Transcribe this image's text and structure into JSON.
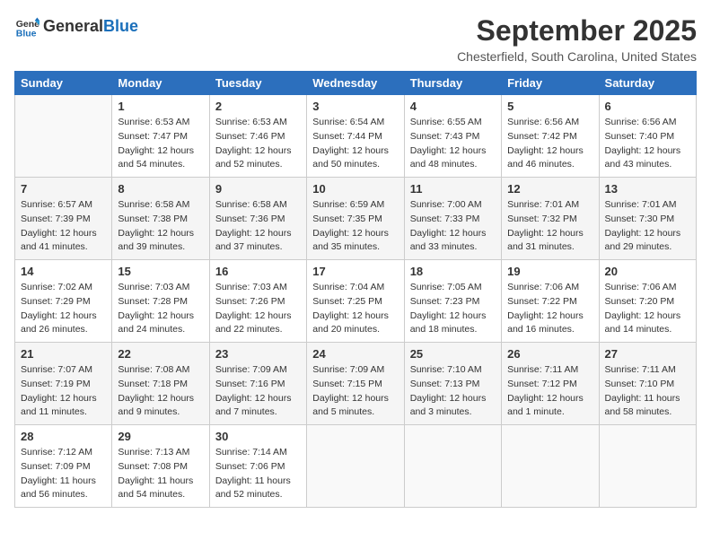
{
  "header": {
    "logo_general": "General",
    "logo_blue": "Blue",
    "month_title": "September 2025",
    "location": "Chesterfield, South Carolina, United States"
  },
  "days_of_week": [
    "Sunday",
    "Monday",
    "Tuesday",
    "Wednesday",
    "Thursday",
    "Friday",
    "Saturday"
  ],
  "weeks": [
    [
      {
        "day": "",
        "info": ""
      },
      {
        "day": "1",
        "info": "Sunrise: 6:53 AM\nSunset: 7:47 PM\nDaylight: 12 hours\nand 54 minutes."
      },
      {
        "day": "2",
        "info": "Sunrise: 6:53 AM\nSunset: 7:46 PM\nDaylight: 12 hours\nand 52 minutes."
      },
      {
        "day": "3",
        "info": "Sunrise: 6:54 AM\nSunset: 7:44 PM\nDaylight: 12 hours\nand 50 minutes."
      },
      {
        "day": "4",
        "info": "Sunrise: 6:55 AM\nSunset: 7:43 PM\nDaylight: 12 hours\nand 48 minutes."
      },
      {
        "day": "5",
        "info": "Sunrise: 6:56 AM\nSunset: 7:42 PM\nDaylight: 12 hours\nand 46 minutes."
      },
      {
        "day": "6",
        "info": "Sunrise: 6:56 AM\nSunset: 7:40 PM\nDaylight: 12 hours\nand 43 minutes."
      }
    ],
    [
      {
        "day": "7",
        "info": "Sunrise: 6:57 AM\nSunset: 7:39 PM\nDaylight: 12 hours\nand 41 minutes."
      },
      {
        "day": "8",
        "info": "Sunrise: 6:58 AM\nSunset: 7:38 PM\nDaylight: 12 hours\nand 39 minutes."
      },
      {
        "day": "9",
        "info": "Sunrise: 6:58 AM\nSunset: 7:36 PM\nDaylight: 12 hours\nand 37 minutes."
      },
      {
        "day": "10",
        "info": "Sunrise: 6:59 AM\nSunset: 7:35 PM\nDaylight: 12 hours\nand 35 minutes."
      },
      {
        "day": "11",
        "info": "Sunrise: 7:00 AM\nSunset: 7:33 PM\nDaylight: 12 hours\nand 33 minutes."
      },
      {
        "day": "12",
        "info": "Sunrise: 7:01 AM\nSunset: 7:32 PM\nDaylight: 12 hours\nand 31 minutes."
      },
      {
        "day": "13",
        "info": "Sunrise: 7:01 AM\nSunset: 7:30 PM\nDaylight: 12 hours\nand 29 minutes."
      }
    ],
    [
      {
        "day": "14",
        "info": "Sunrise: 7:02 AM\nSunset: 7:29 PM\nDaylight: 12 hours\nand 26 minutes."
      },
      {
        "day": "15",
        "info": "Sunrise: 7:03 AM\nSunset: 7:28 PM\nDaylight: 12 hours\nand 24 minutes."
      },
      {
        "day": "16",
        "info": "Sunrise: 7:03 AM\nSunset: 7:26 PM\nDaylight: 12 hours\nand 22 minutes."
      },
      {
        "day": "17",
        "info": "Sunrise: 7:04 AM\nSunset: 7:25 PM\nDaylight: 12 hours\nand 20 minutes."
      },
      {
        "day": "18",
        "info": "Sunrise: 7:05 AM\nSunset: 7:23 PM\nDaylight: 12 hours\nand 18 minutes."
      },
      {
        "day": "19",
        "info": "Sunrise: 7:06 AM\nSunset: 7:22 PM\nDaylight: 12 hours\nand 16 minutes."
      },
      {
        "day": "20",
        "info": "Sunrise: 7:06 AM\nSunset: 7:20 PM\nDaylight: 12 hours\nand 14 minutes."
      }
    ],
    [
      {
        "day": "21",
        "info": "Sunrise: 7:07 AM\nSunset: 7:19 PM\nDaylight: 12 hours\nand 11 minutes."
      },
      {
        "day": "22",
        "info": "Sunrise: 7:08 AM\nSunset: 7:18 PM\nDaylight: 12 hours\nand 9 minutes."
      },
      {
        "day": "23",
        "info": "Sunrise: 7:09 AM\nSunset: 7:16 PM\nDaylight: 12 hours\nand 7 minutes."
      },
      {
        "day": "24",
        "info": "Sunrise: 7:09 AM\nSunset: 7:15 PM\nDaylight: 12 hours\nand 5 minutes."
      },
      {
        "day": "25",
        "info": "Sunrise: 7:10 AM\nSunset: 7:13 PM\nDaylight: 12 hours\nand 3 minutes."
      },
      {
        "day": "26",
        "info": "Sunrise: 7:11 AM\nSunset: 7:12 PM\nDaylight: 12 hours\nand 1 minute."
      },
      {
        "day": "27",
        "info": "Sunrise: 7:11 AM\nSunset: 7:10 PM\nDaylight: 11 hours\nand 58 minutes."
      }
    ],
    [
      {
        "day": "28",
        "info": "Sunrise: 7:12 AM\nSunset: 7:09 PM\nDaylight: 11 hours\nand 56 minutes."
      },
      {
        "day": "29",
        "info": "Sunrise: 7:13 AM\nSunset: 7:08 PM\nDaylight: 11 hours\nand 54 minutes."
      },
      {
        "day": "30",
        "info": "Sunrise: 7:14 AM\nSunset: 7:06 PM\nDaylight: 11 hours\nand 52 minutes."
      },
      {
        "day": "",
        "info": ""
      },
      {
        "day": "",
        "info": ""
      },
      {
        "day": "",
        "info": ""
      },
      {
        "day": "",
        "info": ""
      }
    ]
  ]
}
